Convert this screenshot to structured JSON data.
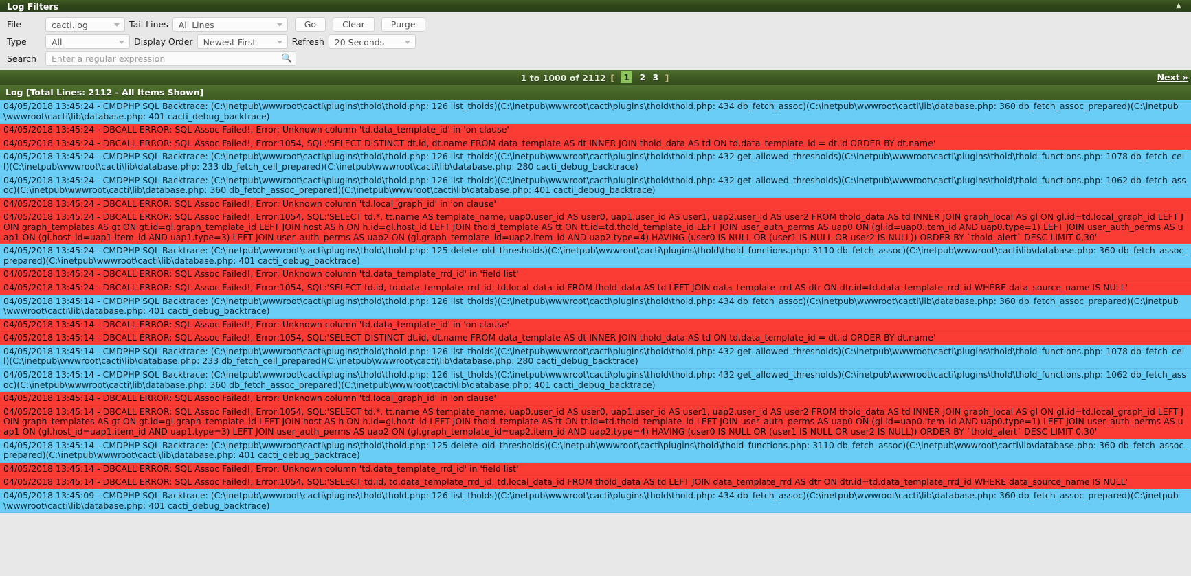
{
  "panel": {
    "title": "Log Filters",
    "collapse_icon": "collapse-icon"
  },
  "filters": {
    "file_label": "File",
    "file_value": "cacti.log",
    "tail_label": "Tail Lines",
    "tail_value": "All Lines",
    "go_label": "Go",
    "clear_label": "Clear",
    "purge_label": "Purge",
    "type_label": "Type",
    "type_value": "All",
    "order_label": "Display Order",
    "order_value": "Newest First",
    "refresh_label": "Refresh",
    "refresh_value": "20 Seconds",
    "search_label": "Search",
    "search_value": "",
    "search_placeholder": "Enter a regular expression",
    "search_icon": "search-icon"
  },
  "pager": {
    "range_text": "1 to 1000 of 2112",
    "bracket_open": "[",
    "bracket_close": "]",
    "pages": [
      "1",
      "2",
      "3"
    ],
    "current_page": "1",
    "next_label": "Next »"
  },
  "log_header": "Log [Total Lines: 2112 - All Items Shown]",
  "colors": {
    "header_green": "#2f4419",
    "pager_green": "#3c5721",
    "log_header_green": "#446226",
    "info_blue": "#69cdf5",
    "error_red": "#fb3c35",
    "page_highlight": "#8cc45a"
  },
  "log_rows": [
    {
      "type": "info",
      "text": "04/05/2018 13:45:24 - CMDPHP SQL Backtrace: (C:\\inetpub\\wwwroot\\cacti\\plugins\\thold\\thold.php: 126 list_tholds)(C:\\inetpub\\wwwroot\\cacti\\plugins\\thold\\thold.php: 434 db_fetch_assoc)(C:\\inetpub\\wwwroot\\cacti\\lib\\database.php: 360 db_fetch_assoc_prepared)(C:\\inetpub\\wwwroot\\cacti\\lib\\database.php: 401 cacti_debug_backtrace)"
    },
    {
      "type": "error",
      "text": "04/05/2018 13:45:24 - DBCALL ERROR: SQL Assoc Failed!, Error: Unknown column 'td.data_template_id' in 'on clause'"
    },
    {
      "type": "error",
      "text": "04/05/2018 13:45:24 - DBCALL ERROR: SQL Assoc Failed!, Error:1054, SQL:'SELECT DISTINCT dt.id, dt.name FROM data_template AS dt INNER JOIN thold_data AS td ON td.data_template_id = dt.id ORDER BY dt.name'"
    },
    {
      "type": "info",
      "text": "04/05/2018 13:45:24 - CMDPHP SQL Backtrace: (C:\\inetpub\\wwwroot\\cacti\\plugins\\thold\\thold.php: 126 list_tholds)(C:\\inetpub\\wwwroot\\cacti\\plugins\\thold\\thold.php: 432 get_allowed_thresholds)(C:\\inetpub\\wwwroot\\cacti\\plugins\\thold\\thold_functions.php: 1078 db_fetch_cell)(C:\\inetpub\\wwwroot\\cacti\\lib\\database.php: 233 db_fetch_cell_prepared)(C:\\inetpub\\wwwroot\\cacti\\lib\\database.php: 280 cacti_debug_backtrace)"
    },
    {
      "type": "info",
      "text": "04/05/2018 13:45:24 - CMDPHP SQL Backtrace: (C:\\inetpub\\wwwroot\\cacti\\plugins\\thold\\thold.php: 126 list_tholds)(C:\\inetpub\\wwwroot\\cacti\\plugins\\thold\\thold.php: 432 get_allowed_thresholds)(C:\\inetpub\\wwwroot\\cacti\\plugins\\thold\\thold_functions.php: 1062 db_fetch_assoc)(C:\\inetpub\\wwwroot\\cacti\\lib\\database.php: 360 db_fetch_assoc_prepared)(C:\\inetpub\\wwwroot\\cacti\\lib\\database.php: 401 cacti_debug_backtrace)"
    },
    {
      "type": "error",
      "text": "04/05/2018 13:45:24 - DBCALL ERROR: SQL Assoc Failed!, Error: Unknown column 'td.local_graph_id' in 'on clause'"
    },
    {
      "type": "error",
      "text": "04/05/2018 13:45:24 - DBCALL ERROR: SQL Assoc Failed!, Error:1054, SQL:'SELECT td.*, tt.name AS template_name, uap0.user_id AS user0, uap1.user_id AS user1, uap2.user_id AS user2 FROM thold_data AS td INNER JOIN graph_local AS gl ON gl.id=td.local_graph_id LEFT JOIN graph_templates AS gt ON gt.id=gl.graph_template_id LEFT JOIN host AS h ON h.id=gl.host_id LEFT JOIN thold_template AS tt ON tt.id=td.thold_template_id LEFT JOIN user_auth_perms AS uap0 ON (gl.id=uap0.item_id AND uap0.type=1) LEFT JOIN user_auth_perms AS uap1 ON (gl.host_id=uap1.item_id AND uap1.type=3) LEFT JOIN user_auth_perms AS uap2 ON (gl.graph_template_id=uap2.item_id AND uap2.type=4) HAVING (user0 IS NULL OR (user1 IS NULL OR user2 IS NULL)) ORDER BY `thold_alert` DESC LIMIT 0,30'"
    },
    {
      "type": "info",
      "text": "04/05/2018 13:45:24 - CMDPHP SQL Backtrace: (C:\\inetpub\\wwwroot\\cacti\\plugins\\thold\\thold.php: 125 delete_old_thresholds)(C:\\inetpub\\wwwroot\\cacti\\plugins\\thold\\thold_functions.php: 3110 db_fetch_assoc)(C:\\inetpub\\wwwroot\\cacti\\lib\\database.php: 360 db_fetch_assoc_prepared)(C:\\inetpub\\wwwroot\\cacti\\lib\\database.php: 401 cacti_debug_backtrace)"
    },
    {
      "type": "error",
      "text": "04/05/2018 13:45:24 - DBCALL ERROR: SQL Assoc Failed!, Error: Unknown column 'td.data_template_rrd_id' in 'field list'"
    },
    {
      "type": "error",
      "text": "04/05/2018 13:45:24 - DBCALL ERROR: SQL Assoc Failed!, Error:1054, SQL:'SELECT td.id, td.data_template_rrd_id, td.local_data_id FROM thold_data AS td LEFT JOIN data_template_rrd AS dtr ON dtr.id=td.data_template_rrd_id WHERE data_source_name IS NULL'"
    },
    {
      "type": "info",
      "text": "04/05/2018 13:45:14 - CMDPHP SQL Backtrace: (C:\\inetpub\\wwwroot\\cacti\\plugins\\thold\\thold.php: 126 list_tholds)(C:\\inetpub\\wwwroot\\cacti\\plugins\\thold\\thold.php: 434 db_fetch_assoc)(C:\\inetpub\\wwwroot\\cacti\\lib\\database.php: 360 db_fetch_assoc_prepared)(C:\\inetpub\\wwwroot\\cacti\\lib\\database.php: 401 cacti_debug_backtrace)"
    },
    {
      "type": "error",
      "text": "04/05/2018 13:45:14 - DBCALL ERROR: SQL Assoc Failed!, Error: Unknown column 'td.data_template_id' in 'on clause'"
    },
    {
      "type": "error",
      "text": "04/05/2018 13:45:14 - DBCALL ERROR: SQL Assoc Failed!, Error:1054, SQL:'SELECT DISTINCT dt.id, dt.name FROM data_template AS dt INNER JOIN thold_data AS td ON td.data_template_id = dt.id ORDER BY dt.name'"
    },
    {
      "type": "info",
      "text": "04/05/2018 13:45:14 - CMDPHP SQL Backtrace: (C:\\inetpub\\wwwroot\\cacti\\plugins\\thold\\thold.php: 126 list_tholds)(C:\\inetpub\\wwwroot\\cacti\\plugins\\thold\\thold.php: 432 get_allowed_thresholds)(C:\\inetpub\\wwwroot\\cacti\\plugins\\thold\\thold_functions.php: 1078 db_fetch_cell)(C:\\inetpub\\wwwroot\\cacti\\lib\\database.php: 233 db_fetch_cell_prepared)(C:\\inetpub\\wwwroot\\cacti\\lib\\database.php: 280 cacti_debug_backtrace)"
    },
    {
      "type": "info",
      "text": "04/05/2018 13:45:14 - CMDPHP SQL Backtrace: (C:\\inetpub\\wwwroot\\cacti\\plugins\\thold\\thold.php: 126 list_tholds)(C:\\inetpub\\wwwroot\\cacti\\plugins\\thold\\thold.php: 432 get_allowed_thresholds)(C:\\inetpub\\wwwroot\\cacti\\plugins\\thold\\thold_functions.php: 1062 db_fetch_assoc)(C:\\inetpub\\wwwroot\\cacti\\lib\\database.php: 360 db_fetch_assoc_prepared)(C:\\inetpub\\wwwroot\\cacti\\lib\\database.php: 401 cacti_debug_backtrace)"
    },
    {
      "type": "error",
      "text": "04/05/2018 13:45:14 - DBCALL ERROR: SQL Assoc Failed!, Error: Unknown column 'td.local_graph_id' in 'on clause'"
    },
    {
      "type": "error",
      "text": "04/05/2018 13:45:14 - DBCALL ERROR: SQL Assoc Failed!, Error:1054, SQL:'SELECT td.*, tt.name AS template_name, uap0.user_id AS user0, uap1.user_id AS user1, uap2.user_id AS user2 FROM thold_data AS td INNER JOIN graph_local AS gl ON gl.id=td.local_graph_id LEFT JOIN graph_templates AS gt ON gt.id=gl.graph_template_id LEFT JOIN host AS h ON h.id=gl.host_id LEFT JOIN thold_template AS tt ON tt.id=td.thold_template_id LEFT JOIN user_auth_perms AS uap0 ON (gl.id=uap0.item_id AND uap0.type=1) LEFT JOIN user_auth_perms AS uap1 ON (gl.host_id=uap1.item_id AND uap1.type=3) LEFT JOIN user_auth_perms AS uap2 ON (gl.graph_template_id=uap2.item_id AND uap2.type=4) HAVING (user0 IS NULL OR (user1 IS NULL OR user2 IS NULL)) ORDER BY `thold_alert` DESC LIMIT 0,30'"
    },
    {
      "type": "info",
      "text": "04/05/2018 13:45:14 - CMDPHP SQL Backtrace: (C:\\inetpub\\wwwroot\\cacti\\plugins\\thold\\thold.php: 125 delete_old_thresholds)(C:\\inetpub\\wwwroot\\cacti\\plugins\\thold\\thold_functions.php: 3110 db_fetch_assoc)(C:\\inetpub\\wwwroot\\cacti\\lib\\database.php: 360 db_fetch_assoc_prepared)(C:\\inetpub\\wwwroot\\cacti\\lib\\database.php: 401 cacti_debug_backtrace)"
    },
    {
      "type": "error",
      "text": "04/05/2018 13:45:14 - DBCALL ERROR: SQL Assoc Failed!, Error: Unknown column 'td.data_template_rrd_id' in 'field list'"
    },
    {
      "type": "error",
      "text": "04/05/2018 13:45:14 - DBCALL ERROR: SQL Assoc Failed!, Error:1054, SQL:'SELECT td.id, td.data_template_rrd_id, td.local_data_id FROM thold_data AS td LEFT JOIN data_template_rrd AS dtr ON dtr.id=td.data_template_rrd_id WHERE data_source_name IS NULL'"
    },
    {
      "type": "info",
      "text": "04/05/2018 13:45:09 - CMDPHP SQL Backtrace: (C:\\inetpub\\wwwroot\\cacti\\plugins\\thold\\thold.php: 126 list_tholds)(C:\\inetpub\\wwwroot\\cacti\\plugins\\thold\\thold.php: 434 db_fetch_assoc)(C:\\inetpub\\wwwroot\\cacti\\lib\\database.php: 360 db_fetch_assoc_prepared)(C:\\inetpub\\wwwroot\\cacti\\lib\\database.php: 401 cacti_debug_backtrace)"
    }
  ]
}
